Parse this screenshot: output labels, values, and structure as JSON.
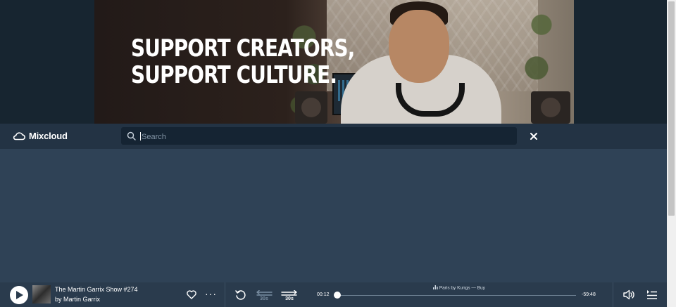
{
  "hero": {
    "headline": "SUPPORT CREATORS,\nSUPPORT CULTURE."
  },
  "navbar": {
    "brand": "Mixcloud",
    "search_placeholder": "Search",
    "search_value": "",
    "icons": [
      "mixcloud-logo-icon",
      "search-icon",
      "close-icon"
    ]
  },
  "player": {
    "track_title": "The Martin Garrix Show #274",
    "track_artist": "by Martin Garrix",
    "skip_back_label": "30s",
    "skip_forward_label": "30s",
    "time_elapsed": "00:12",
    "time_remaining": "-59:48",
    "now_playing_text": "Paris by Kungs — Buy",
    "progress_fraction": 0.003,
    "icons": [
      "play-icon",
      "heart-icon",
      "more-icon",
      "replay-icon",
      "skip-back-icon",
      "skip-forward-icon",
      "chart-icon",
      "volume-icon",
      "queue-icon"
    ]
  },
  "colors": {
    "page_bg": "#2f4256",
    "navbar_bg": "#233344",
    "search_bg": "#152433",
    "player_bg": "#2a3b4d"
  }
}
